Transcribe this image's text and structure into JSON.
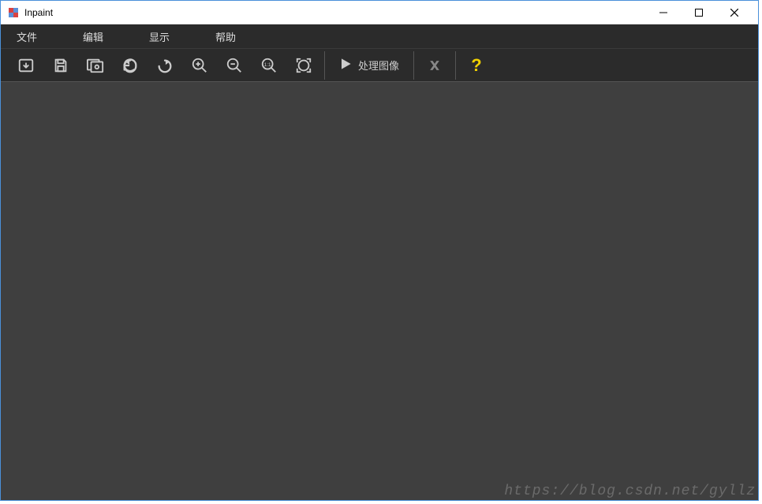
{
  "app": {
    "title": "Inpaint"
  },
  "menubar": {
    "file": "文件",
    "edit": "编辑",
    "view": "显示",
    "help": "帮助"
  },
  "toolbar": {
    "open": "open",
    "save": "save",
    "compare": "compare",
    "undo": "undo",
    "redo": "redo",
    "zoom_in": "zoom-in",
    "zoom_out": "zoom-out",
    "zoom_actual": "zoom-1-1",
    "zoom_fit": "zoom-fit",
    "process_label": "处理图像",
    "cancel": "cancel",
    "help": "?"
  },
  "watermark": "https://blog.csdn.net/gyllz"
}
